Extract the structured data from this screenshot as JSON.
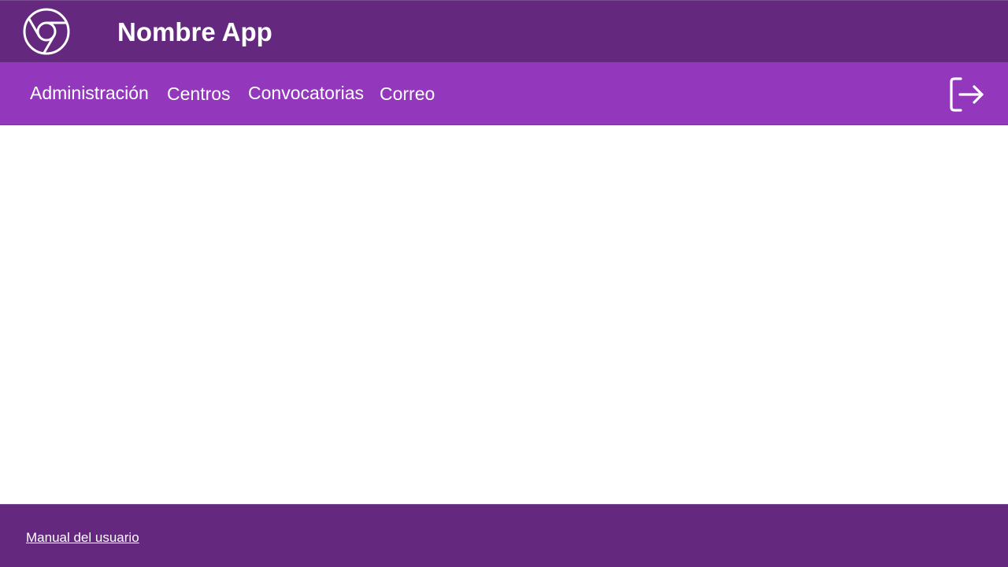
{
  "app": {
    "title": "Nombre App",
    "logo_icon": "chrome-logo-icon"
  },
  "nav": {
    "items": [
      {
        "label": "Administración"
      },
      {
        "label": "Centros"
      },
      {
        "label": "Convocatorias"
      },
      {
        "label": "Correo"
      }
    ],
    "logout_icon": "logout-icon"
  },
  "footer": {
    "manual_link": "Manual del usuario"
  },
  "colors": {
    "header_bg": "#64287e",
    "nav_bg": "#9337bc",
    "footer_bg": "#64287e",
    "text": "#ffffff"
  }
}
